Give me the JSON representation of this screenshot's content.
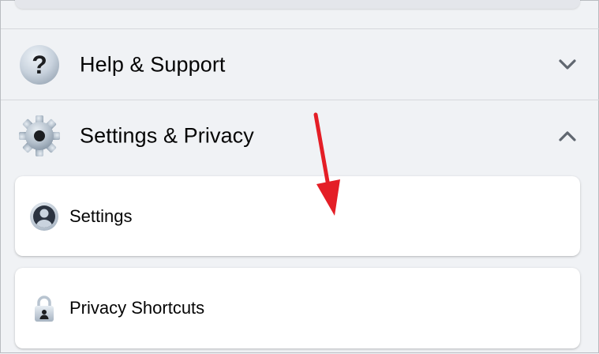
{
  "menu": {
    "sections": [
      {
        "label": "Help & Support",
        "icon": "question-mark-icon",
        "expanded": false
      },
      {
        "label": "Settings & Privacy",
        "icon": "gear-icon",
        "expanded": true
      }
    ],
    "settings_privacy_items": [
      {
        "label": "Settings",
        "icon": "profile-icon"
      },
      {
        "label": "Privacy Shortcuts",
        "icon": "lock-icon"
      }
    ]
  },
  "colors": {
    "background": "#f0f2f5",
    "card": "#ffffff",
    "text": "#050505",
    "icon_gray": "#606770",
    "annotation_arrow": "#e41e26"
  }
}
